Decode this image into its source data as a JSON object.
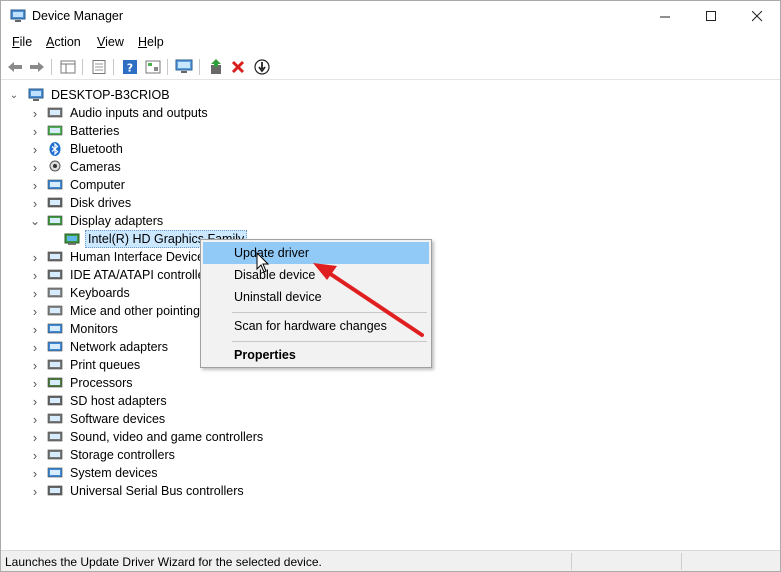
{
  "window": {
    "title": "Device Manager",
    "controls": {
      "minimize": "—",
      "maximize": "☐",
      "close": "✕"
    }
  },
  "menu": [
    {
      "label": "File"
    },
    {
      "label": "Action"
    },
    {
      "label": "View"
    },
    {
      "label": "Help"
    }
  ],
  "toolbar": {
    "buttons": [
      "back-arrow-icon",
      "forward-arrow-icon",
      "properties-icon",
      "show-hidden-icon",
      "help-icon",
      "console-icon",
      "scan-hardware-icon",
      "update-driver-icon",
      "uninstall-icon",
      "disable-device-icon"
    ]
  },
  "tree": {
    "root": "DESKTOP-B3CRIOB",
    "categories": [
      "Audio inputs and outputs",
      "Batteries",
      "Bluetooth",
      "Cameras",
      "Computer",
      "Disk drives",
      "Display adapters",
      "Human Interface Devices",
      "IDE ATA/ATAPI controllers",
      "Keyboards",
      "Mice and other pointing devices",
      "Monitors",
      "Network adapters",
      "Print queues",
      "Processors",
      "SD host adapters",
      "Software devices",
      "Sound, video and game controllers",
      "Storage controllers",
      "System devices",
      "Universal Serial Bus controllers"
    ],
    "display_child": "Intel(R) HD Graphics Family",
    "expanded": "Display adapters"
  },
  "context_menu": {
    "items": [
      {
        "label": "Update driver",
        "highlighted": true
      },
      {
        "label": "Disable device"
      },
      {
        "label": "Uninstall device"
      },
      {
        "label": "Scan for hardware changes"
      },
      {
        "label": "Properties",
        "bold": true
      }
    ]
  },
  "status": {
    "text": "Launches the Update Driver Wizard for the selected device."
  },
  "colors": {
    "selection": "#cce8ff",
    "menu_highlight": "#91c9f7",
    "annotation_arrow": "#e02020"
  }
}
